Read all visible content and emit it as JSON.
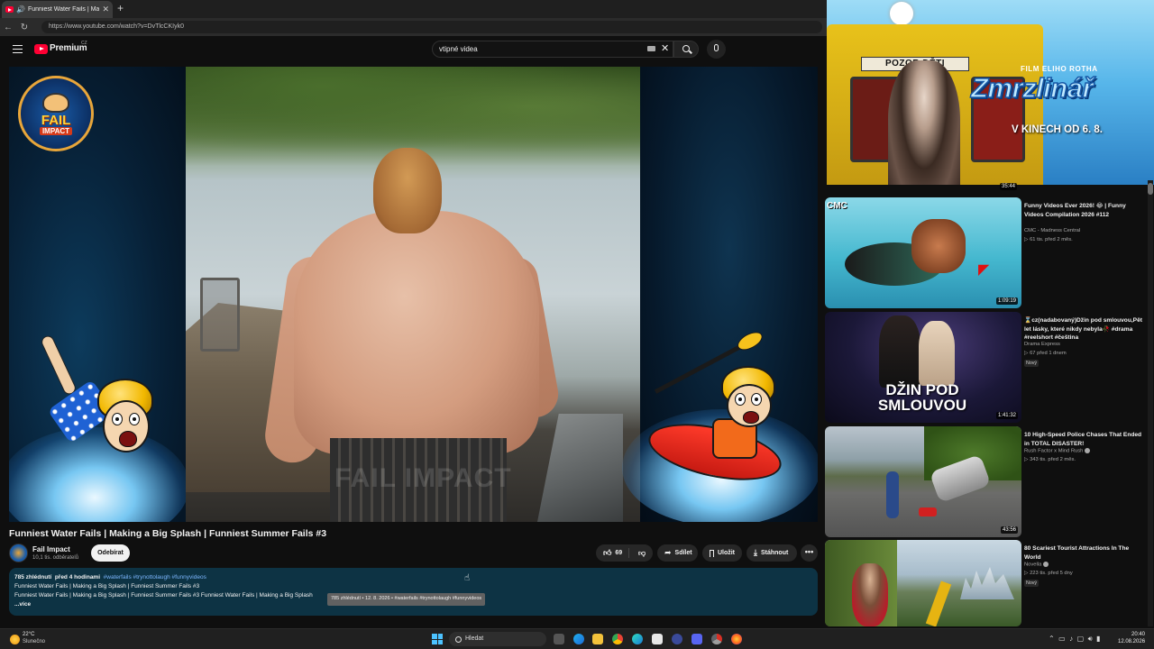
{
  "browser": {
    "tab_title": "Funniest Water Fails | Making a Big Splash",
    "tab_close": "✕",
    "new_tab": "+",
    "url": "https://www.youtube.com/watch?v=DvTlcCKIyk0"
  },
  "youtube": {
    "logo_text": "Premium",
    "logo_country": "CZ",
    "search_query": "vtipné videa"
  },
  "player": {
    "badge_top": "FAIL",
    "badge_bottom": "IMPACT",
    "watermark": "FAIL IMPACT"
  },
  "video": {
    "title": "Funniest Water Fails | Making a Big Splash | Funniest Summer Fails #3",
    "channel": "Fail Impact",
    "subscribers": "10,1 tis. odběratelů",
    "subscribe_label": "Odebírat",
    "likes": "69",
    "share_label": "Sdílet",
    "save_label": "Uložit",
    "download_label": "Stáhnout",
    "more_label": "•••"
  },
  "description": {
    "views": "785 zhlédnutí",
    "age": "před 4 hodinami",
    "tags": "#waterfails #trynottolaugh #funnyvideos",
    "line2": "Funniest Water Fails | Making a Big Splash | Funniest Summer Fails #3",
    "line3": "Funniest Water Fails | Making a Big Splash | Funniest Summer Fails #3 Funniest Water Fails | Making a Big Splash",
    "more": "...více",
    "tooltip": "785 zhlédnutí • 12. 8. 2026 • #waterfails #trynottolaugh #funnyvideos"
  },
  "ad": {
    "sign": "POZOR DĚTI",
    "film_label": "FILM ELIHO ROTHA",
    "title": "Zmrzlinář",
    "date": "V KINECH OD 6. 8.",
    "duration": "35:44"
  },
  "recommendations": [
    {
      "title": "Funny Videos Ever 2026! 😂 | Funny Videos Compilation 2026 #112",
      "channel": "CMC - Madness Central",
      "meta": "▷ 61 tis.   před 2 měs.",
      "duration": "1:09:19",
      "thumb_label": "CMC",
      "badge": ""
    },
    {
      "title": "⌛cz(nadabovaný)Džin pod smlouvou,Pět let lásky, které nikdy nebyla🥀 #drama #reelshort #čeština",
      "channel": "Drama Express",
      "meta": "▷ 67   před 1 dnem",
      "duration": "1:41:32",
      "thumb_label": "DŽIN POD SMLOUVOU",
      "badge": "Nový"
    },
    {
      "title": "10 High-Speed Police Chases That Ended in TOTAL DISASTER!",
      "channel": "Rush Factor x Mind Rush",
      "meta": "▷ 343 tis.   před 2 měs.",
      "duration": "43:56",
      "thumb_label": "",
      "badge": ""
    },
    {
      "title": "80 Scariest Tourist Attractions In The World",
      "channel": "Novella",
      "meta": "▷ 223 tis.   před 5 dny",
      "duration": "",
      "thumb_label": "",
      "badge": "Nový"
    }
  ],
  "taskbar": {
    "temperature": "22°C",
    "condition": "Slunečno",
    "search_label": "Hledat",
    "time": "20:40",
    "date": "12.08.2026"
  },
  "colors": {
    "accent_red": "#ff0033",
    "description_bg": "#0d3344",
    "link_blue": "#7db7ff"
  }
}
